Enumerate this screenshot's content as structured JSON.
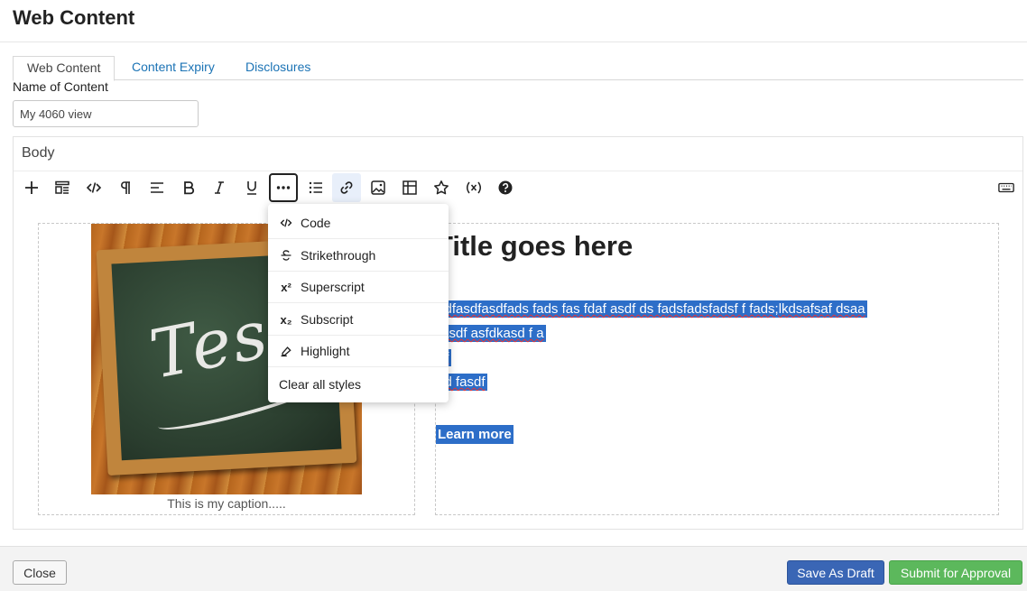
{
  "header": {
    "title": "Web Content"
  },
  "tabs": [
    {
      "label": "Web Content"
    },
    {
      "label": "Content Expiry"
    },
    {
      "label": "Disclosures"
    }
  ],
  "form": {
    "name_label": "Name of Content",
    "name_value": "My 4060 view"
  },
  "editor": {
    "body_label": "Body",
    "toolbar": [
      {
        "icon": "plus-icon"
      },
      {
        "icon": "template-icon"
      },
      {
        "icon": "code-icon"
      },
      {
        "icon": "paragraph-icon"
      },
      {
        "icon": "align-left-icon"
      },
      {
        "icon": "bold-icon"
      },
      {
        "icon": "italic-icon"
      },
      {
        "icon": "underline-icon"
      },
      {
        "icon": "more-icon"
      },
      {
        "icon": "bullet-list-icon"
      },
      {
        "icon": "link-icon"
      },
      {
        "icon": "image-icon"
      },
      {
        "icon": "table-icon"
      },
      {
        "icon": "star-icon"
      },
      {
        "icon": "variable-icon"
      },
      {
        "icon": "help-icon"
      },
      {
        "icon": "keyboard-icon"
      }
    ],
    "image_text": "Test",
    "caption": "This is my caption.....",
    "title": "Title goes here",
    "selected_lines": [
      "sdfasdfasdfads fads fas fdaf asdf ds fadsfadsfadsf f  fads;lkdsafsaf dsaa",
      "fasdf asfdkasd f a",
      "df",
      "sd fasdf"
    ],
    "learn_more": "Learn more"
  },
  "more_menu": {
    "items": [
      {
        "label": "Code",
        "icon": "code-icon"
      },
      {
        "label": "Strikethrough",
        "icon": "strikethrough-icon"
      },
      {
        "label": "Superscript",
        "icon": "superscript-icon"
      },
      {
        "label": "Subscript",
        "icon": "subscript-icon"
      },
      {
        "label": "Highlight",
        "icon": "highlight-icon"
      },
      {
        "label": "Clear all styles",
        "icon": ""
      }
    ]
  },
  "footer": {
    "close": "Close",
    "save_draft": "Save As Draft",
    "submit": "Submit for Approval"
  },
  "colors": {
    "selection": "#2d6ec8",
    "primary_button": "#3a66b5",
    "success_button": "#5cb85c",
    "link": "#1b73b5"
  }
}
